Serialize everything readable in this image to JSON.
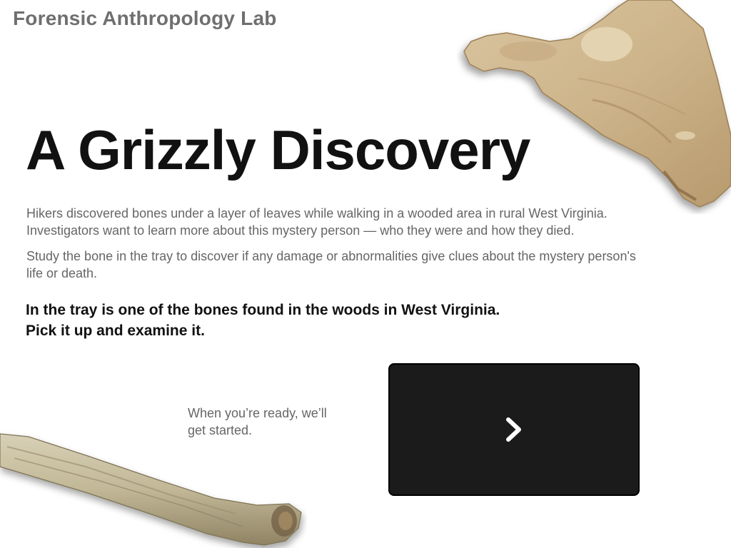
{
  "header": {
    "app_title": "Forensic Anthropology Lab"
  },
  "main": {
    "title": "A Grizzly Discovery",
    "intro_paragraphs": [
      "Hikers discovered bones under a layer of leaves while walking in a wooded area in rural West Virginia. Investigators want to learn more about this mystery person — who they were and how they died.",
      "Study the bone in the tray to discover if any damage or abnormalities give clues about the mystery person's life or death."
    ],
    "instruction_lines": [
      "In the tray is one of the bones found in the woods in West Virginia.",
      "Pick it up and examine it."
    ],
    "ready_text": "When you’re ready, we’ll get started."
  },
  "next_button": {
    "icon": "chevron-right-icon",
    "color": "#1b1b1b",
    "icon_color": "#ffffff"
  },
  "images": {
    "top_right": "scapula-bone",
    "bottom_left": "long-bone"
  }
}
